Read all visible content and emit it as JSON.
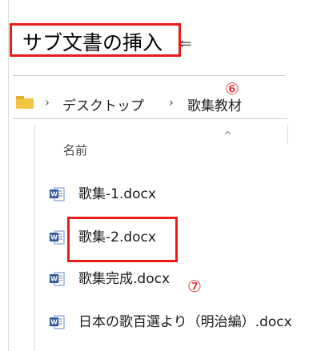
{
  "dialog": {
    "title": "サブ文書の挿入",
    "title_arrow": "⇐",
    "callout_breadcrumb": "⑥",
    "callout_file": "⑦"
  },
  "breadcrumb": {
    "chevron": "›",
    "items": [
      "デスクトップ",
      "歌集教材"
    ]
  },
  "file_list": {
    "column_name": "名前",
    "scroll_up_glyph": "^",
    "files": [
      {
        "name": "歌集-1.docx",
        "icon": "word-document-icon"
      },
      {
        "name": "歌集-2.docx",
        "icon": "word-document-icon",
        "highlighted": true
      },
      {
        "name": "歌集完成.docx",
        "icon": "word-document-icon"
      },
      {
        "name": "日本の歌百選より（明治編）.docx",
        "icon": "word-document-icon"
      }
    ]
  },
  "colors": {
    "annotation_red": "#ea1b1b",
    "word_blue": "#2b579a",
    "folder_yellow": "#f4c542"
  }
}
